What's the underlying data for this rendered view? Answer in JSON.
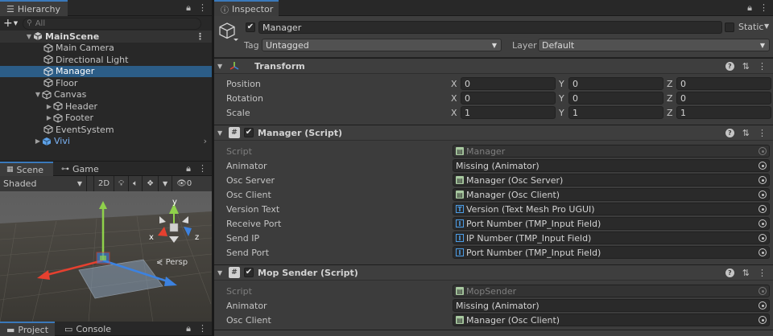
{
  "hierarchy": {
    "tab_label": "Hierarchy",
    "search_placeholder": "All",
    "scene_name": "MainScene",
    "items": [
      {
        "label": "Main Camera"
      },
      {
        "label": "Directional Light"
      },
      {
        "label": "Manager"
      },
      {
        "label": "Floor"
      },
      {
        "label": "Canvas"
      },
      {
        "label": "Header"
      },
      {
        "label": "Footer"
      },
      {
        "label": "EventSystem"
      },
      {
        "label": "Vivi"
      }
    ]
  },
  "scene_view": {
    "tabs": [
      {
        "label": "Scene"
      },
      {
        "label": "Game"
      }
    ],
    "shading_mode": "Shaded",
    "mode_2d": "2D",
    "hidden_count": "0",
    "axis_labels": {
      "x": "x",
      "y": "y",
      "z": "z"
    },
    "projection_label": "Persp"
  },
  "bottom_tabs": [
    {
      "label": "Project"
    },
    {
      "label": "Console"
    }
  ],
  "inspector": {
    "tab_label": "Inspector",
    "object_name": "Manager",
    "static_label": "Static",
    "tag_label": "Tag",
    "tag_value": "Untagged",
    "layer_label": "Layer",
    "layer_value": "Default",
    "transform": {
      "title": "Transform",
      "rows": [
        {
          "label": "Position",
          "x": "0",
          "y": "0",
          "z": "0"
        },
        {
          "label": "Rotation",
          "x": "0",
          "y": "0",
          "z": "0"
        },
        {
          "label": "Scale",
          "x": "1",
          "y": "1",
          "z": "1"
        }
      ],
      "axis": {
        "x": "X",
        "y": "Y",
        "z": "Z"
      }
    },
    "manager_script": {
      "title": "Manager (Script)",
      "rows": [
        {
          "label": "Script",
          "value": "Manager"
        },
        {
          "label": "Animator",
          "value": "Missing (Animator)"
        },
        {
          "label": "Osc Server",
          "value": "Manager (Osc Server)"
        },
        {
          "label": "Osc Client",
          "value": "Manager (Osc Client)"
        },
        {
          "label": "Version Text",
          "value": "Version (Text Mesh Pro UGUI)"
        },
        {
          "label": "Receive Port",
          "value": "Port Number (TMP_Input Field)"
        },
        {
          "label": "Send IP",
          "value": "IP Number (TMP_Input Field)"
        },
        {
          "label": "Send Port",
          "value": "Port Number (TMP_Input Field)"
        }
      ]
    },
    "mop_sender": {
      "title": "Mop Sender (Script)",
      "rows": [
        {
          "label": "Script",
          "value": "MopSender"
        },
        {
          "label": "Animator",
          "value": "Missing (Animator)"
        },
        {
          "label": "Osc Client",
          "value": "Manager (Osc Client)"
        }
      ]
    }
  },
  "colors": {
    "selection": "#2c5d87",
    "accent_tab": "#3a79bb",
    "prefab_text": "#7cb3f4"
  }
}
